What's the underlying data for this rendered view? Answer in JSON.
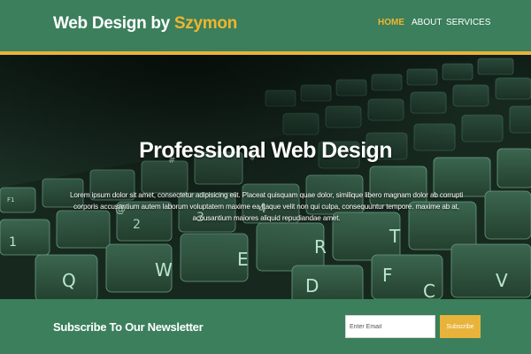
{
  "header": {
    "brand_prefix": "Web Design by ",
    "brand_highlight": "Szymon",
    "nav": [
      {
        "label": "HOME",
        "active": true
      },
      {
        "label": "ABOUT",
        "active": false
      },
      {
        "label": "SERVICES",
        "active": false
      }
    ]
  },
  "hero": {
    "title": "Professional Web Design",
    "text": "Lorem ipsum dolor sit amet, consectetur adipisicing elit. Placeat quisquam quae dolor, similique libero magnam dolor ab corrupti corporis accusantium autem laborum voluptatem maxime ea itaque velit non qui culpa, consequuntur tempore. maxime ab at, accusantium maiores aliquid repudiandae amet.",
    "keys": [
      "F1",
      "@",
      "#",
      "$",
      "1",
      "2",
      "3",
      "4",
      "Q",
      "W",
      "E",
      "R",
      "T",
      "D",
      "F",
      "C",
      "V"
    ]
  },
  "newsletter": {
    "title": "Subscribe To Our Newsletter",
    "email_placeholder": "Enter Email",
    "button_label": "Subscribe"
  },
  "colors": {
    "header_bg": "#3b7f5c",
    "accent": "#e8b33a",
    "brand_highlight": "#f0b52e"
  }
}
